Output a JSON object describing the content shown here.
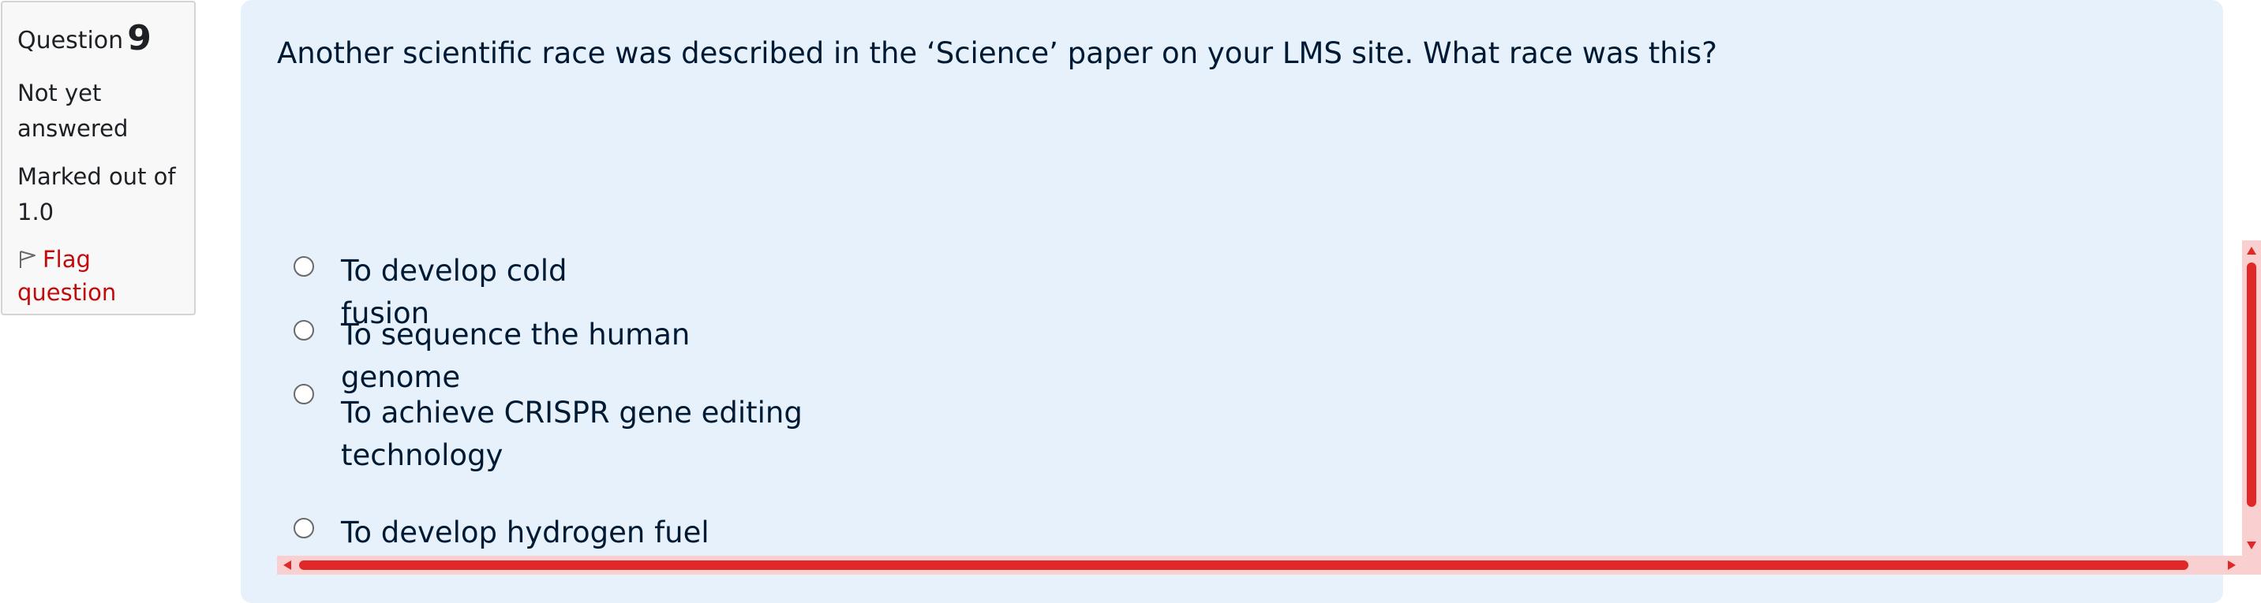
{
  "info": {
    "question_label": "Question",
    "question_number": "9",
    "state": "Not yet answered",
    "grade": "Marked out of 1.0",
    "flag_label": "Flag question",
    "flag_icon": "flag-icon"
  },
  "question": {
    "text": "Another scientific race was described in the ‘Science’ paper on your LMS site. What race was this?",
    "options": [
      {
        "label": "To develop cold fusion",
        "selected": false
      },
      {
        "label": "To sequence the human genome",
        "selected": false
      },
      {
        "label": "To achieve CRISPR gene editing technology",
        "selected": false
      },
      {
        "label": "To develop hydrogen fuel",
        "selected": false
      }
    ]
  },
  "colors": {
    "panel_background": "#e6f1fb",
    "flag_text": "#c30a0a",
    "scrollbar": "#e02828",
    "scrollbar_track": "#f9cfcf"
  }
}
